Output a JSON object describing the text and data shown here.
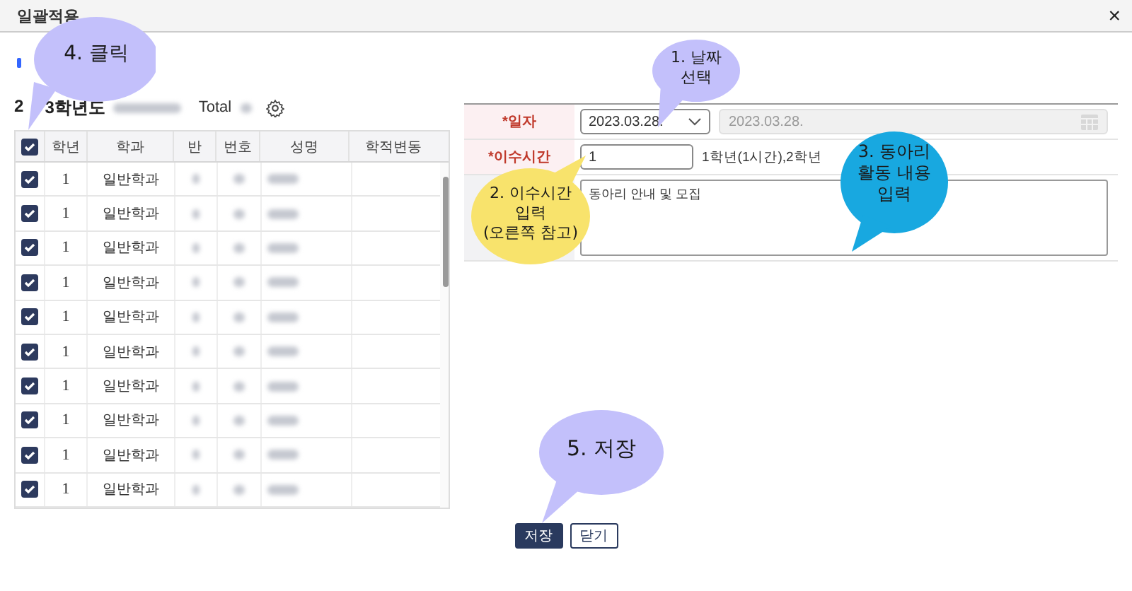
{
  "window": {
    "title": "일괄적용",
    "close": "×"
  },
  "list": {
    "title_parts": [
      "2",
      "3학년도"
    ],
    "total_label": "Total",
    "select_all": true,
    "columns": [
      "학년",
      "학과",
      "반",
      "번호",
      "성명",
      "학적변동"
    ],
    "rows": [
      {
        "checked": true,
        "grade": "1",
        "department": "일반학과"
      },
      {
        "checked": true,
        "grade": "1",
        "department": "일반학과"
      },
      {
        "checked": true,
        "grade": "1",
        "department": "일반학과"
      },
      {
        "checked": true,
        "grade": "1",
        "department": "일반학과"
      },
      {
        "checked": true,
        "grade": "1",
        "department": "일반학과"
      },
      {
        "checked": true,
        "grade": "1",
        "department": "일반학과"
      },
      {
        "checked": true,
        "grade": "1",
        "department": "일반학과"
      },
      {
        "checked": true,
        "grade": "1",
        "department": "일반학과"
      },
      {
        "checked": true,
        "grade": "1",
        "department": "일반학과"
      },
      {
        "checked": true,
        "grade": "1",
        "department": "일반학과"
      }
    ]
  },
  "form": {
    "date_label": "*일자",
    "date_value": "2023.03.28.",
    "date_end": "2023.03.28.",
    "hours_label": "*이수시간",
    "hours_value": "1",
    "hours_hint": "1학년(1시간),2학년",
    "content": "동아리 안내 및 모집"
  },
  "buttons": [
    {
      "label": "저장",
      "kind": "primary"
    },
    {
      "label": "닫기",
      "kind": "secondary"
    }
  ],
  "callouts": [
    {
      "lines": [
        "4. 클릭"
      ],
      "color": "#c3c0fb"
    },
    {
      "lines": [
        "1. 날짜",
        "선택"
      ],
      "color": "#c3c0fb"
    },
    {
      "lines": [
        "2. 이수시간",
        "입력",
        "(오른쪽 참고)"
      ],
      "color": "#f8e36c"
    },
    {
      "lines": [
        "3. 동아리",
        "활동 내용",
        "입력"
      ],
      "color": "#18a8e0"
    },
    {
      "lines": [
        "5. 저장"
      ],
      "color": "#c3c0fb"
    }
  ]
}
